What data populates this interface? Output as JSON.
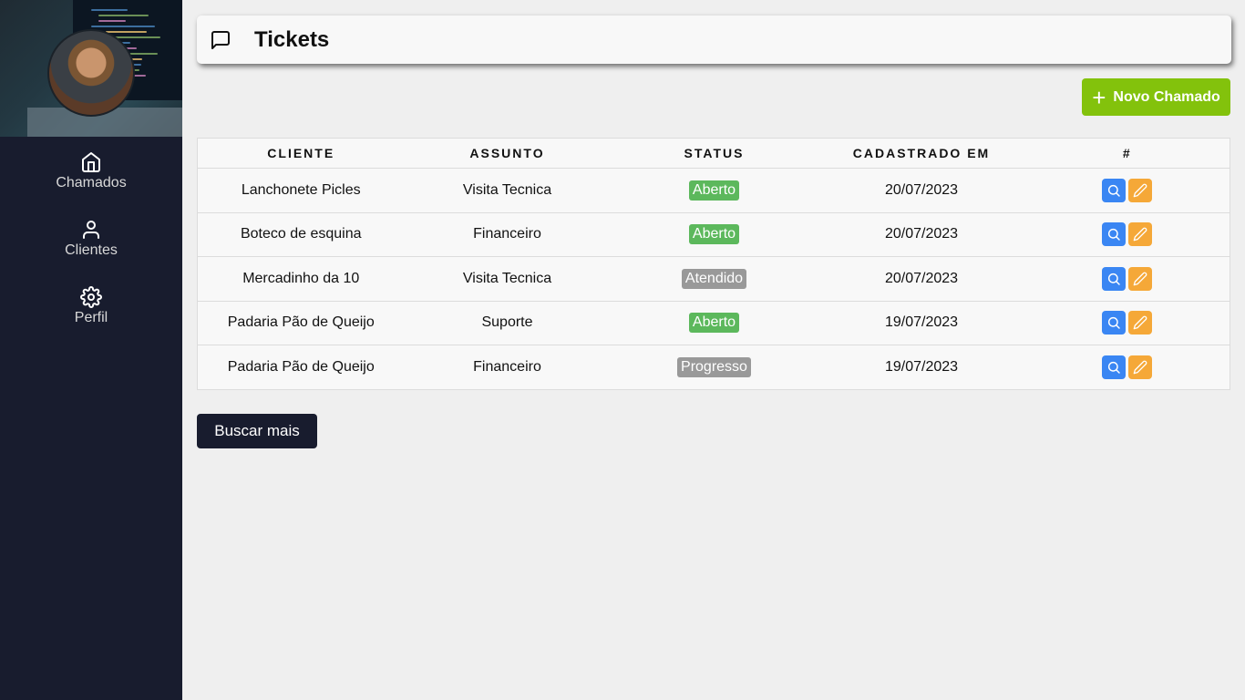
{
  "sidebar": {
    "items": [
      {
        "label": "Chamados",
        "icon": "home-icon"
      },
      {
        "label": "Clientes",
        "icon": "user-icon"
      },
      {
        "label": "Perfil",
        "icon": "gear-icon"
      }
    ]
  },
  "header": {
    "title": "Tickets",
    "icon": "message-square-icon"
  },
  "actions": {
    "new_ticket_label": "Novo Chamado",
    "load_more_label": "Buscar mais"
  },
  "table": {
    "columns": [
      "CLIENTE",
      "ASSUNTO",
      "STATUS",
      "CADASTRADO EM",
      "#"
    ],
    "rows": [
      {
        "cliente": "Lanchonete Picles",
        "assunto": "Visita Tecnica",
        "status": "Aberto",
        "cadastrado": "20/07/2023"
      },
      {
        "cliente": "Boteco de esquina",
        "assunto": "Financeiro",
        "status": "Aberto",
        "cadastrado": "20/07/2023"
      },
      {
        "cliente": "Mercadinho da 10",
        "assunto": "Visita Tecnica",
        "status": "Atendido",
        "cadastrado": "20/07/2023"
      },
      {
        "cliente": "Padaria Pão de Queijo",
        "assunto": "Suporte",
        "status": "Aberto",
        "cadastrado": "19/07/2023"
      },
      {
        "cliente": "Padaria Pão de Queijo",
        "assunto": "Financeiro",
        "status": "Progresso",
        "cadastrado": "19/07/2023"
      }
    ]
  },
  "colors": {
    "sidebar_bg": "#181c2e",
    "status_aberto": "#5cb85c",
    "status_other": "#999999",
    "new_button": "#83c20c",
    "view_button": "#3a86f3",
    "edit_button": "#f5a838"
  }
}
